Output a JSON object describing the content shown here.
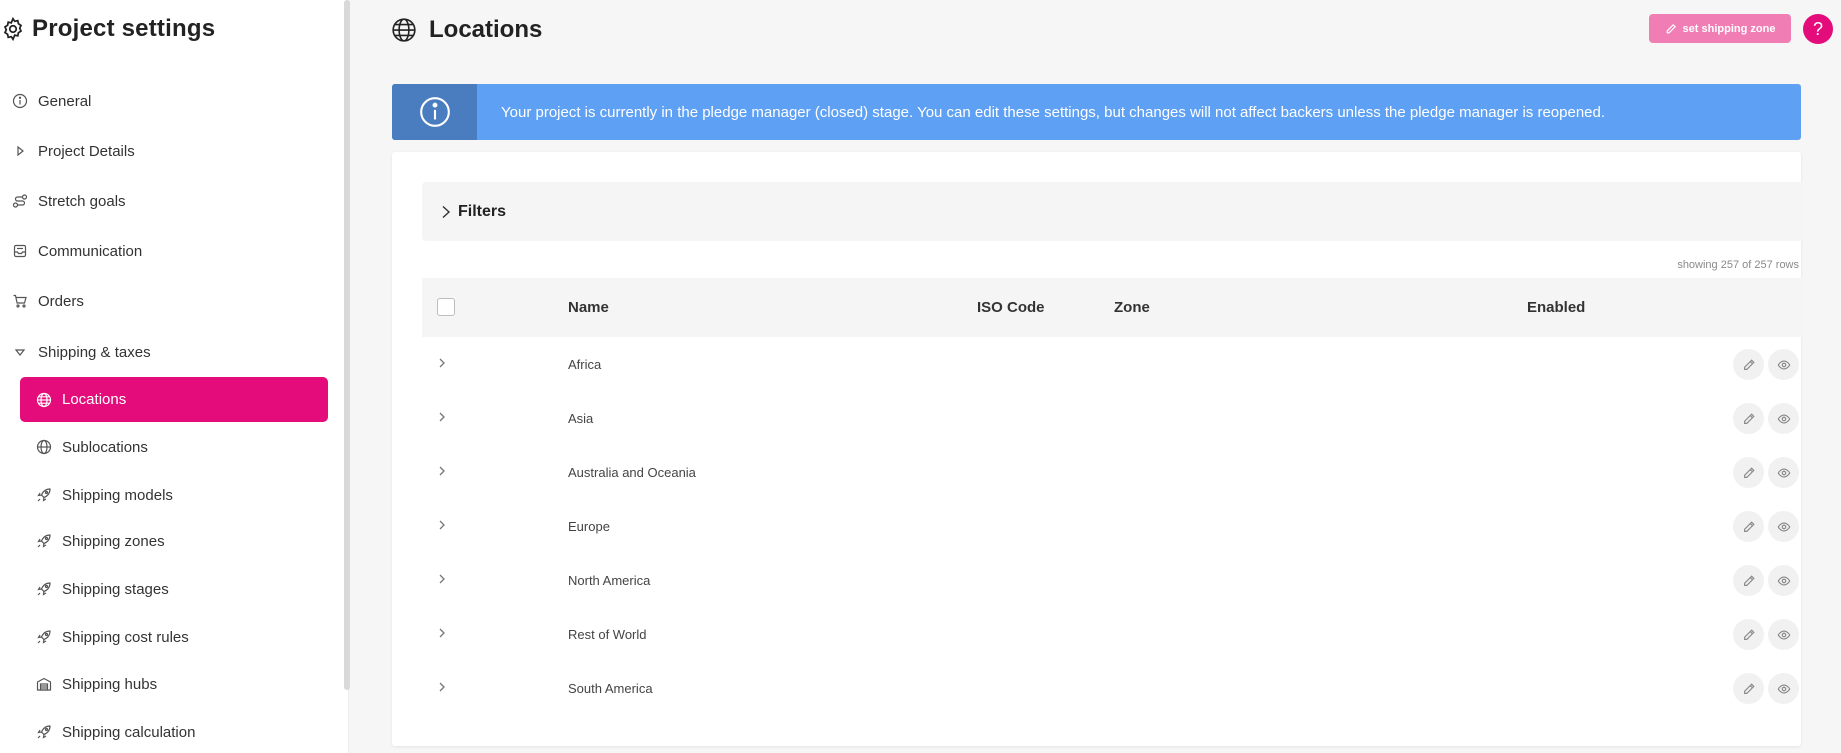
{
  "sidebar": {
    "title": "Project settings",
    "items": [
      {
        "label": "General"
      },
      {
        "label": "Project Details"
      },
      {
        "label": "Stretch goals"
      },
      {
        "label": "Communication"
      },
      {
        "label": "Orders"
      },
      {
        "label": "Shipping & taxes"
      },
      {
        "label": "Locations"
      },
      {
        "label": "Sublocations"
      },
      {
        "label": "Shipping models"
      },
      {
        "label": "Shipping zones"
      },
      {
        "label": "Shipping stages"
      },
      {
        "label": "Shipping cost rules"
      },
      {
        "label": "Shipping hubs"
      },
      {
        "label": "Shipping calculation"
      }
    ]
  },
  "header": {
    "title": "Locations",
    "set_zone_label": "set shipping zone",
    "help_label": "?"
  },
  "banner": {
    "text": "Your project is currently in the pledge manager (closed) stage. You can edit these settings, but changes will not affect backers unless the pledge manager is reopened."
  },
  "filters": {
    "label": "Filters"
  },
  "table": {
    "rows_count": "showing 257 of 257 rows",
    "columns": {
      "name": "Name",
      "iso": "ISO Code",
      "zone": "Zone",
      "enabled": "Enabled"
    },
    "rows": [
      {
        "name": "Africa"
      },
      {
        "name": "Asia"
      },
      {
        "name": "Australia and Oceania"
      },
      {
        "name": "Europe"
      },
      {
        "name": "North America"
      },
      {
        "name": "Rest of World"
      },
      {
        "name": "South America"
      }
    ]
  },
  "colors": {
    "accent": "#e40b7b",
    "accent_light": "#f07db3",
    "banner": "#5ea0f4",
    "banner_dark": "#4a7dc0"
  },
  "icons": {
    "title": "gear-icon",
    "header": "globe-icon",
    "banner": "info-icon",
    "row_edit": "pencil-icon",
    "row_view": "eye-icon"
  }
}
